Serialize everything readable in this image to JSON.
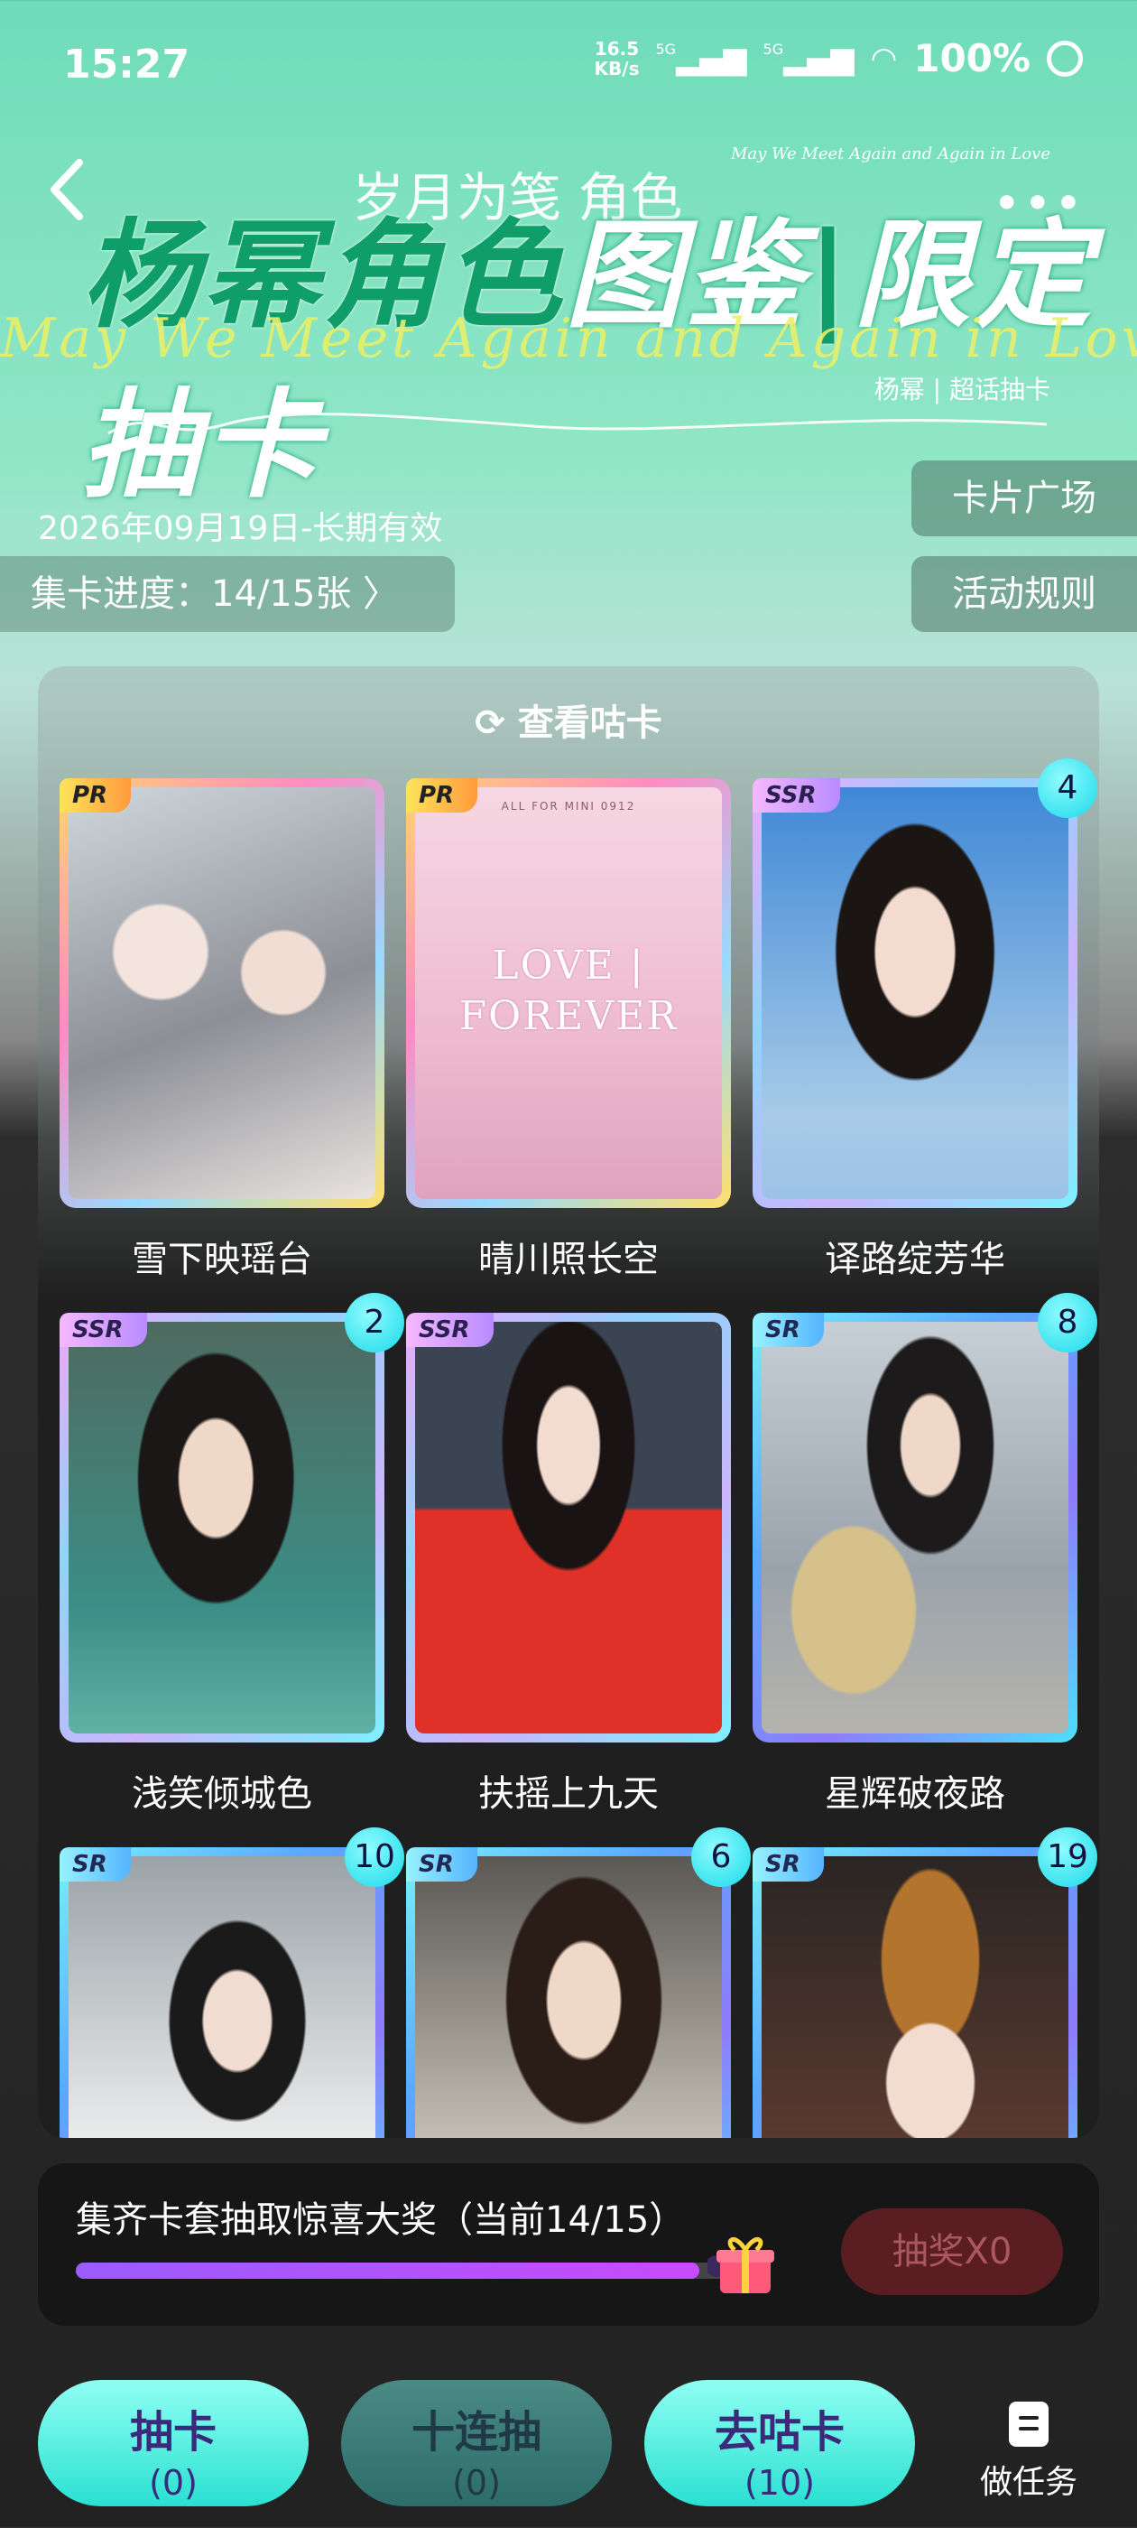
{
  "status_bar": {
    "time": "15:27",
    "net_speed_value": "16.5",
    "net_speed_unit": "KB/s",
    "network_1": "5G",
    "network_2": "5G",
    "battery": "100%"
  },
  "header": {
    "subtitle": "岁月为笺  角色",
    "title_main": "杨幂角色",
    "title_hl": "图鉴",
    "title_sep": "|",
    "title_tail": "限定抽卡",
    "english_small": "May We Meet Again and Again in Love",
    "english_big": "May We Meet Again and Again in Love",
    "author": "杨幂 | 超话抽卡"
  },
  "validity": "2026年09月19日-长期有效",
  "progress_label": "集卡进度：14/15张 〉",
  "side_buttons": {
    "plaza": "卡片广场",
    "rules": "活动规则"
  },
  "panel": {
    "title": "查看咕卡"
  },
  "cards": [
    {
      "name": "雪下映瑶台",
      "rarity": "PR",
      "count": null
    },
    {
      "name": "晴川照长空",
      "rarity": "PR",
      "count": null,
      "art_top": "ALL FOR MINI   0912",
      "art_line1": "LOVE |",
      "art_line2": "FOREVER"
    },
    {
      "name": "译路绽芳华",
      "rarity": "SSR",
      "count": "4"
    },
    {
      "name": "浅笑倾城色",
      "rarity": "SSR",
      "count": "2"
    },
    {
      "name": "扶摇上九天",
      "rarity": "SSR",
      "count": null
    },
    {
      "name": "星辉破夜路",
      "rarity": "SR",
      "count": "8"
    },
    {
      "name": "",
      "rarity": "SR",
      "count": "10"
    },
    {
      "name": "",
      "rarity": "SR",
      "count": "6"
    },
    {
      "name": "",
      "rarity": "SR",
      "count": "19"
    }
  ],
  "reward": {
    "text": "集齐卡套抽取惊喜大奖（当前14/15）",
    "progress_fraction": 0.9333,
    "draw_button": "抽奖X0"
  },
  "bottom_nav": {
    "draw_label": "抽卡",
    "draw_count": "(0)",
    "ten_label": "十连抽",
    "ten_count": "(0)",
    "gu_label": "去咕卡",
    "gu_count": "(10)",
    "task_label": "做任务"
  },
  "colors": {
    "accent_teal": "#2ae0d2",
    "title_green": "#0f9d6a",
    "progress_purple": "#9b5cff"
  }
}
